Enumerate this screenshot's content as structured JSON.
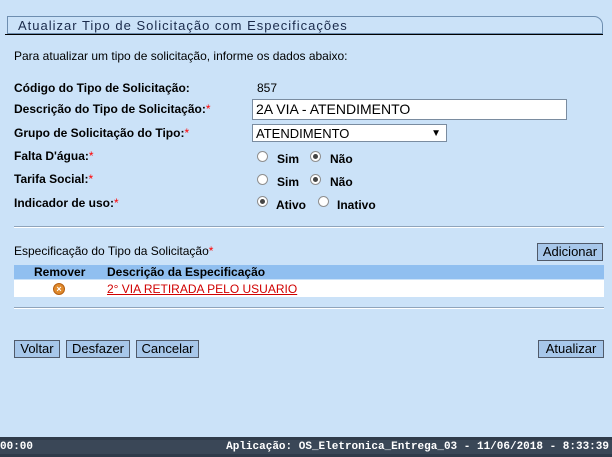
{
  "header": {
    "title": "Atualizar Tipo de Solicitação com Especificações"
  },
  "intro": "Para atualizar um tipo de solicitação, informe os dados abaixo:",
  "form": {
    "codigo": {
      "label": "Código do Tipo de Solicitação:",
      "value": "857"
    },
    "descricao": {
      "label": "Descrição do Tipo de Solicitação:",
      "required": "*",
      "value": "2A VIA - ATENDIMENTO"
    },
    "grupo": {
      "label": "Grupo de Solicitação do Tipo:",
      "required": "*",
      "selected": "ATENDIMENTO"
    },
    "falta_agua": {
      "label": "Falta D'água:",
      "required": "*",
      "options": [
        "Sim",
        "Não"
      ],
      "selected": "Não"
    },
    "tarifa_social": {
      "label": "Tarifa Social:",
      "required": "*",
      "options": [
        "Sim",
        "Não"
      ],
      "selected": "Não"
    },
    "indicador_uso": {
      "label": "Indicador de uso:",
      "required": "*",
      "options": [
        "Ativo",
        "Inativo"
      ],
      "selected": "Ativo"
    }
  },
  "especificacao": {
    "label": "Especificação do Tipo da Solicitação",
    "required": "*",
    "add_button": "Adicionar",
    "columns": [
      "Remover",
      "Descrição da Especificação"
    ],
    "rows": [
      {
        "descricao": "2° VIA RETIRADA PELO USUARIO",
        "remove_icon": "remove-x-icon"
      }
    ]
  },
  "actions": {
    "voltar": "Voltar",
    "desfazer": "Desfazer",
    "cancelar": "Cancelar",
    "atualizar": "Atualizar"
  },
  "status_bar": {
    "time": "00:00",
    "app": "Aplicação: OS_Eletronica_Entrega_03 - 11/06/2018 - 8:33:39"
  },
  "colors": {
    "background": "#cbe2f8",
    "table_header": "#90bff0",
    "button": "#a7c7ea",
    "required": "#ff0000",
    "link": "#d00000",
    "status_bar": "#2f3b4a"
  }
}
